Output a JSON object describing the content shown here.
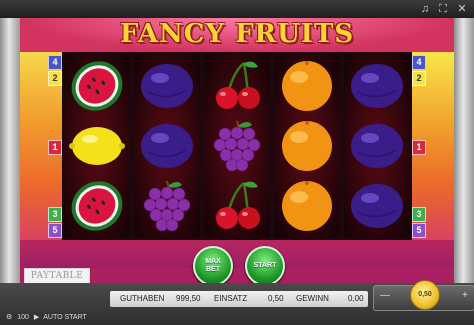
{
  "game": {
    "title": "FANCY FRUITS"
  },
  "top_controls": {
    "icons": [
      "sound-icon",
      "fullscreen-icon",
      "close-icon"
    ]
  },
  "lines": {
    "left": [
      {
        "label": "4",
        "color": "#4a55c9",
        "text": "#ffffff"
      },
      {
        "label": "2",
        "color": "#f4e24a",
        "text": "#333333"
      },
      {
        "label": "1",
        "color": "#d9283b",
        "text": "#ffffff"
      },
      {
        "label": "3",
        "color": "#3fae4f",
        "text": "#ffffff"
      },
      {
        "label": "5",
        "color": "#8a4fc9",
        "text": "#ffffff"
      }
    ],
    "right": [
      {
        "label": "4",
        "color": "#4a55c9",
        "text": "#ffffff"
      },
      {
        "label": "2",
        "color": "#f4e24a",
        "text": "#333333"
      },
      {
        "label": "1",
        "color": "#d9283b",
        "text": "#ffffff"
      },
      {
        "label": "3",
        "color": "#3fae4f",
        "text": "#ffffff"
      },
      {
        "label": "5",
        "color": "#8a4fc9",
        "text": "#ffffff"
      }
    ]
  },
  "reels": [
    [
      "watermelon",
      "lemon",
      "watermelon"
    ],
    [
      "plum",
      "plum",
      "grapes"
    ],
    [
      "cherries",
      "grapes",
      "cherries"
    ],
    [
      "orange",
      "orange",
      "orange"
    ],
    [
      "plum",
      "plum",
      "plum"
    ]
  ],
  "buttons": {
    "paytable": "PAYTABLE",
    "max_bet_line1": "MAX",
    "max_bet_line2": "BET",
    "start": "START",
    "autostart": "AUTO START",
    "autostart_count": "100"
  },
  "status": {
    "credit_label": "GUTHABEN",
    "credit_value": "999,50",
    "bet_label": "EINSATZ",
    "bet_value": "0,50",
    "win_label": "GEWINN",
    "win_value": "0,00",
    "coin_value": "0,50"
  },
  "colors": {
    "cabinet": "#c42a55",
    "title_text": "#ffd23a",
    "button_green": "#1f9b2a",
    "coin_gold": "#f1c232"
  }
}
